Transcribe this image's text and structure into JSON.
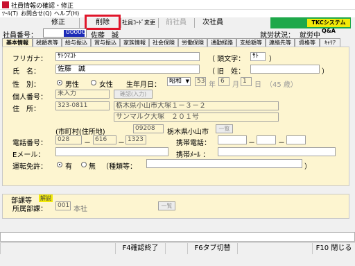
{
  "window": {
    "title": "社員情報の確認・修正"
  },
  "menu": [
    "ﾂｰﾙ(T)",
    "お問合せ(Q)",
    "ヘルプ(H)"
  ],
  "toolbar": {
    "buttons": [
      {
        "label": "修正",
        "enabled": true
      },
      {
        "label": "削除",
        "enabled": true
      },
      {
        "label": "社員ｺｰﾄﾞ変更",
        "enabled": true
      },
      {
        "label": "前社員",
        "enabled": false
      },
      {
        "label": "次社員",
        "enabled": true
      }
    ],
    "brand": "TKCシステムQ&A"
  },
  "employee": {
    "number_label": "社員番号：",
    "number_value": "00000",
    "name": "佐藤　誠",
    "status_label": "就労状況：",
    "status_value": "就労中"
  },
  "tabs": [
    "基本情報",
    "税額表等",
    "給与振込",
    "賞与振込",
    "家族情報",
    "社会保険",
    "労働保険",
    "通勤経路",
    "支給額等",
    "連絡先等",
    "資格等",
    "ｷｬﾘｱ"
  ],
  "form": {
    "furigana_label": "フリガナ：",
    "furigana_value": "ｻﾄｳﾏｺﾄ",
    "initial_label": "（ 頭文字：",
    "initial_value": "ｻﾄ",
    "initial_close": "）",
    "name_label": "氏　名：",
    "name_value": "佐藤　誠",
    "oldname_label": "（ 旧　姓：",
    "oldname_close": "）",
    "gender_label": "性　別：",
    "male": "男性",
    "female": "女性",
    "birth_label": "生年月日：",
    "era": "昭和",
    "year": "53",
    "year_unit": "年",
    "month": "6",
    "month_unit": "月",
    "day": "1",
    "day_unit": "日",
    "age": "（45 歳）",
    "mynumber_label": "個人番号：",
    "mynumber_value": "未入力",
    "mynumber_button": "確認(入力)",
    "address_label": "住　所：",
    "postal": "323-0811",
    "address1": "栃木県小山市大塚１－３－２",
    "address2": "サンマルク大塚　２０１号",
    "city_label": "(市町村(住所地)",
    "city_code": "09208",
    "city_name": "栃木県小山市",
    "list_button": "一覧",
    "phone_label": "電話番号：",
    "phone1": "028",
    "phone2": "616",
    "phone3": "1323",
    "dash": "－",
    "mobile_label": "携帯電話：",
    "email_label": "Eメール：",
    "mobile_mail_label": "携帯ﾒｰﾙ ：",
    "license_label": "運転免許：",
    "license_yes": "有",
    "license_no": "無",
    "license_type_label": "（種類等：",
    "license_type_close": "）"
  },
  "dept": {
    "section_label": "部課等",
    "tag": "解説",
    "label": "所属部課：",
    "code": "001",
    "name": "本社",
    "button": "一覧"
  },
  "fkeys": [
    "F4確認終了",
    "F6タブ切替",
    "F10 閉じる"
  ]
}
